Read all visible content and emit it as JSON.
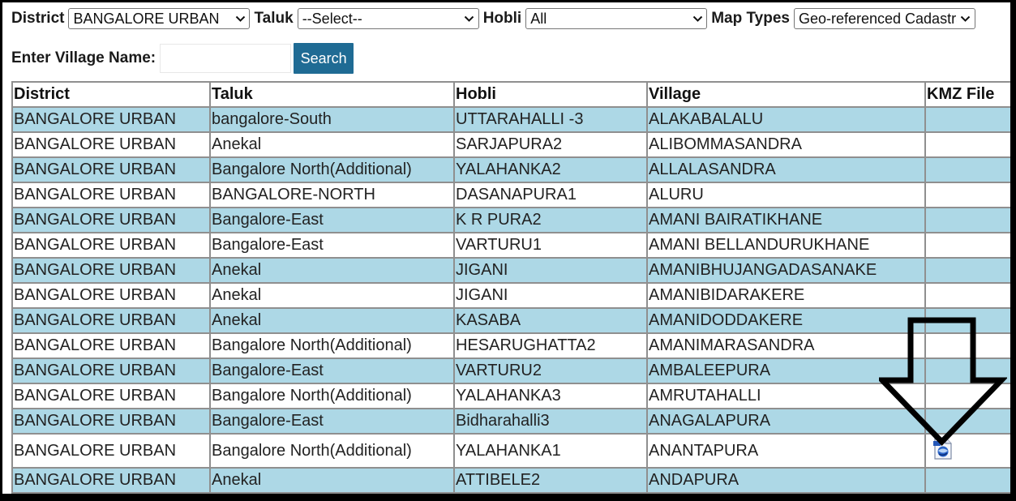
{
  "filters": {
    "district": {
      "label": "District",
      "value": "BANGALORE URBAN"
    },
    "taluk": {
      "label": "Taluk",
      "value": "--Select--"
    },
    "hobli": {
      "label": "Hobli",
      "value": "All"
    },
    "map_types": {
      "label": "Map Types",
      "value": "Geo-referenced Cadastral"
    }
  },
  "village_search": {
    "label": "Enter Village Name:",
    "value": "",
    "button_label": "Search"
  },
  "table": {
    "headers": [
      "District",
      "Taluk",
      "Hobli",
      "Village",
      "KMZ File"
    ],
    "rows": [
      [
        "BANGALORE URBAN",
        "bangalore-South",
        "UTTARAHALLI -3",
        "ALAKABALALU"
      ],
      [
        "BANGALORE URBAN",
        "Anekal",
        "SARJAPURA2",
        "ALIBOMMASANDRA"
      ],
      [
        "BANGALORE URBAN",
        "Bangalore North(Additional)",
        "YALAHANKA2",
        "ALLALASANDRA"
      ],
      [
        "BANGALORE URBAN",
        "BANGALORE-NORTH",
        "DASANAPURA1",
        "ALURU"
      ],
      [
        "BANGALORE URBAN",
        "Bangalore-East",
        "K R PURA2",
        "AMANI BAIRATIKHANE"
      ],
      [
        "BANGALORE URBAN",
        "Bangalore-East",
        "VARTURU1",
        "AMANI BELLANDURUKHANE"
      ],
      [
        "BANGALORE URBAN",
        "Anekal",
        "JIGANI",
        "AMANIBHUJANGADASANAKE"
      ],
      [
        "BANGALORE URBAN",
        "Anekal",
        "JIGANI",
        "AMANIBIDARAKERE"
      ],
      [
        "BANGALORE URBAN",
        "Anekal",
        "KASABA",
        "AMANIDODDAKERE"
      ],
      [
        "BANGALORE URBAN",
        "Bangalore North(Additional)",
        "HESARUGHATTA2",
        "AMANIMARASANDRA"
      ],
      [
        "BANGALORE URBAN",
        "Bangalore-East",
        "VARTURU2",
        "AMBALEEPURA"
      ],
      [
        "BANGALORE URBAN",
        "Bangalore North(Additional)",
        "YALAHANKA3",
        "AMRUTAHALLI"
      ],
      [
        "BANGALORE URBAN",
        "Bangalore-East",
        "Bidharahalli3",
        "ANAGALAPURA"
      ],
      [
        "BANGALORE URBAN",
        "Bangalore North(Additional)",
        "YALAHANKA1",
        "ANANTAPURA"
      ],
      [
        "BANGALORE URBAN",
        "Anekal",
        "ATTIBELE2",
        "ANDAPURA"
      ]
    ],
    "kmz_row_index": 13,
    "kmz_icon": "kmz-file-icon"
  },
  "colors": {
    "row_highlight": "#add8e6",
    "button": "#1f6b94",
    "border": "#8f8f8f",
    "annotation_arrow": "#000000"
  },
  "annotation": {
    "icon": "down-arrow-icon"
  }
}
